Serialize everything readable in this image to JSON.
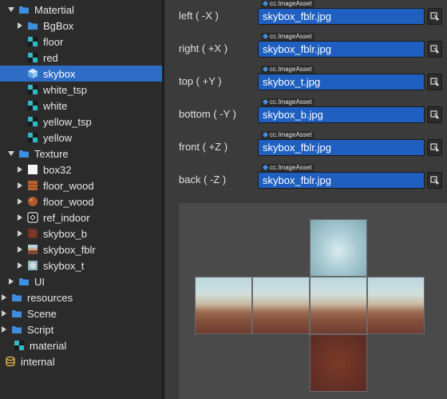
{
  "tree": {
    "items": [
      {
        "label": "Matertial",
        "icon": "folder-icon"
      },
      {
        "label": "BgBox",
        "icon": "folder-icon"
      },
      {
        "label": "floor",
        "icon": "material-icon"
      },
      {
        "label": "red",
        "icon": "material-icon"
      },
      {
        "label": "skybox",
        "icon": "cube-icon"
      },
      {
        "label": "white_tsp",
        "icon": "material-icon"
      },
      {
        "label": "white",
        "icon": "material-icon"
      },
      {
        "label": "yellow_tsp",
        "icon": "material-icon"
      },
      {
        "label": "yellow",
        "icon": "material-icon"
      },
      {
        "label": "Texture",
        "icon": "folder-icon"
      },
      {
        "label": "box32",
        "icon": "texture-icon"
      },
      {
        "label": "floor_wood",
        "icon": "texture-icon"
      },
      {
        "label": "floor_wood",
        "icon": "texture-icon"
      },
      {
        "label": "ref_indoor",
        "icon": "texture-icon"
      },
      {
        "label": "skybox_b",
        "icon": "texture-icon"
      },
      {
        "label": "skybox_fblr",
        "icon": "texture-icon"
      },
      {
        "label": "skybox_t",
        "icon": "texture-icon"
      },
      {
        "label": "UI",
        "icon": "folder-icon"
      },
      {
        "label": "resources",
        "icon": "folder-icon"
      },
      {
        "label": "Scene",
        "icon": "folder-icon"
      },
      {
        "label": "Script",
        "icon": "folder-icon"
      },
      {
        "label": "material",
        "icon": "material-icon"
      },
      {
        "label": "internal",
        "icon": "database-icon"
      }
    ]
  },
  "inspector": {
    "asset_type": "cc.ImageAsset",
    "faces": [
      {
        "label": "left ( -X )",
        "value": "skybox_fblr.jpg"
      },
      {
        "label": "right ( +X )",
        "value": "skybox_fblr.jpg"
      },
      {
        "label": "top ( +Y )",
        "value": "skybox_t.jpg"
      },
      {
        "label": "bottom ( -Y )",
        "value": "skybox_b.jpg"
      },
      {
        "label": "front ( +Z )",
        "value": "skybox_fblr.jpg"
      },
      {
        "label": "back ( -Z )",
        "value": "skybox_fblr.jpg"
      }
    ]
  },
  "colors": {
    "selection": "#2d6bc4",
    "folder": "#3b8fe0",
    "field": "#1f5fc0"
  }
}
